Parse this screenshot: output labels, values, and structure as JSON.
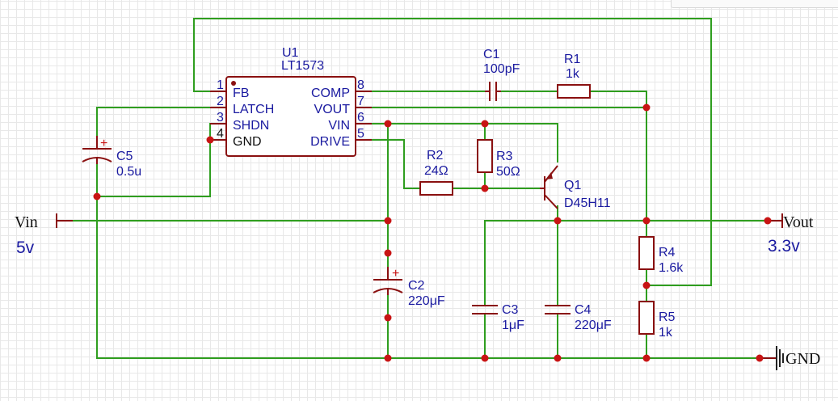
{
  "chip": {
    "ref": "U1",
    "part": "LT1573",
    "left_pins": [
      {
        "num": "1",
        "name": "FB"
      },
      {
        "num": "2",
        "name": "LATCH"
      },
      {
        "num": "3",
        "name": "SHDN"
      },
      {
        "num": "4",
        "name": "GND"
      }
    ],
    "right_pins": [
      {
        "num": "8",
        "name": "COMP"
      },
      {
        "num": "7",
        "name": "VOUT"
      },
      {
        "num": "6",
        "name": "VIN"
      },
      {
        "num": "5",
        "name": "DRIVE"
      }
    ]
  },
  "components": {
    "C1": {
      "ref": "C1",
      "value": "100pF"
    },
    "R1": {
      "ref": "R1",
      "value": "1k"
    },
    "C5": {
      "ref": "C5",
      "value": "0.5u"
    },
    "R2": {
      "ref": "R2",
      "value": "24Ω"
    },
    "R3": {
      "ref": "R3",
      "value": "50Ω"
    },
    "Q1": {
      "ref": "Q1",
      "value": "D45H11"
    },
    "C2": {
      "ref": "C2",
      "value": "220μF"
    },
    "C3": {
      "ref": "C3",
      "value": "1μF"
    },
    "C4": {
      "ref": "C4",
      "value": "220μF"
    },
    "R4": {
      "ref": "R4",
      "value": "1.6k"
    },
    "R5": {
      "ref": "R5",
      "value": "1k"
    }
  },
  "nets": {
    "vin": {
      "name": "Vin",
      "voltage": "5v"
    },
    "vout": {
      "name": "Vout",
      "voltage": "3.3v"
    },
    "gnd": {
      "name": "GND"
    }
  },
  "colors": {
    "wire": "#2f9e1f",
    "component": "#8a1010",
    "label": "#1a1aa0",
    "junction": "#c81414"
  }
}
